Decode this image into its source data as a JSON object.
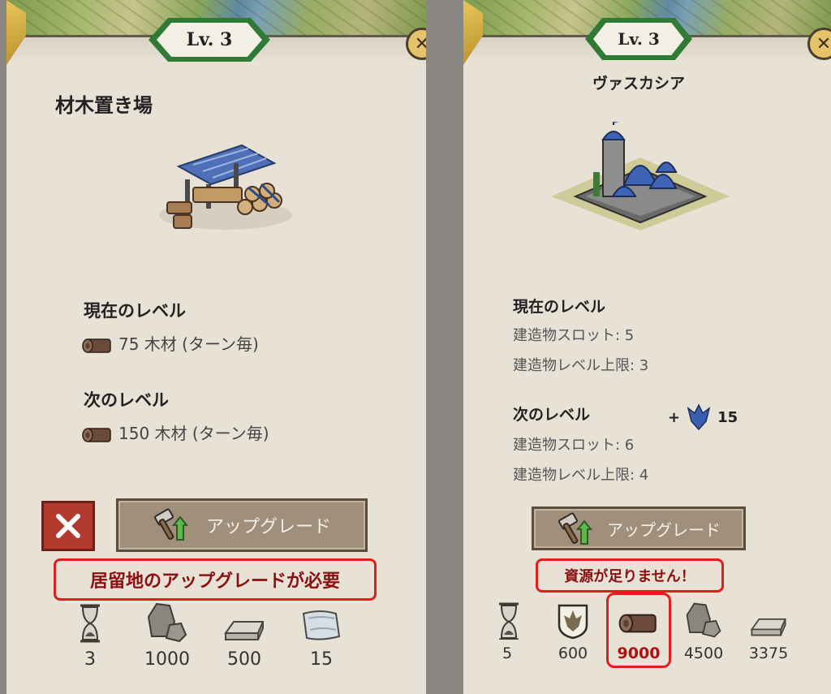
{
  "left_panel": {
    "level": "Lv. 3",
    "title": "材木置き場",
    "current_level_label": "現在のレベル",
    "current_value": "75 木材 (ターン毎)",
    "next_level_label": "次のレベル",
    "next_value": "150 木材 (ターン毎)",
    "upgrade_label": "アップグレード",
    "cancel_icon": "close-x-icon",
    "warning": "居留地のアップグレードが必要",
    "resources": [
      {
        "icon": "hourglass-icon",
        "value": "3"
      },
      {
        "icon": "stone-icon",
        "value": "1000"
      },
      {
        "icon": "iron-ingot-icon",
        "value": "500"
      },
      {
        "icon": "cloth-icon",
        "value": "15"
      }
    ]
  },
  "right_panel": {
    "level": "Lv. 3",
    "title": "ヴァスカシア",
    "current_level_label": "現在のレベル",
    "current_lines": [
      "建造物スロット: 5",
      "建造物レベル上限: 3"
    ],
    "next_level_label": "次のレベル",
    "bonus_prefix": "+",
    "bonus_value": "15",
    "next_lines": [
      "建造物スロット: 6",
      "建造物レベル上限: 4"
    ],
    "upgrade_label": "アップグレード",
    "warning": "資源が足りません！",
    "resources": [
      {
        "icon": "hourglass-icon",
        "value": "5"
      },
      {
        "icon": "emblem-icon",
        "value": "600"
      },
      {
        "icon": "wood-log-icon",
        "value": "9000",
        "insufficient": true
      },
      {
        "icon": "stone-icon",
        "value": "4500"
      },
      {
        "icon": "iron-ingot-icon",
        "value": "3375"
      }
    ]
  },
  "colors": {
    "panel_bg": "#e7e1d6",
    "level_badge_green": "#2f7a35",
    "upgrade_button": "#a08f7b",
    "cancel_button": "#b23a2f",
    "warning_red": "#e01e1e",
    "warning_text": "#8b1010"
  }
}
